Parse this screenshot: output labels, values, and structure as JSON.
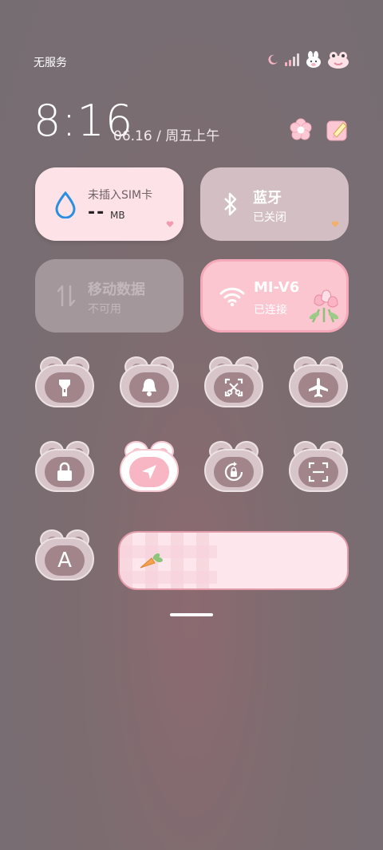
{
  "status": {
    "carrier": "无服务",
    "icons": [
      "moon-icon",
      "signal-icon",
      "bunny-sticker-icon",
      "frog-sticker-icon"
    ]
  },
  "header": {
    "time": "8:16",
    "date": "06.16 / 周五上午",
    "icons": [
      "flower-settings-icon",
      "edit-icon"
    ]
  },
  "tiles": {
    "data": {
      "title": "未插入SIM卡",
      "value": "--",
      "unit": "MB"
    },
    "bluetooth": {
      "title": "蓝牙",
      "sub": "已关闭"
    },
    "mobile": {
      "title": "移动数据",
      "sub": "不可用"
    },
    "wifi": {
      "title": "MI-V6",
      "sub": "已连接"
    }
  },
  "toggles": [
    {
      "icon": "flashlight-icon",
      "active": false
    },
    {
      "icon": "bell-icon",
      "active": false
    },
    {
      "icon": "screenshot-icon",
      "active": false
    },
    {
      "icon": "airplane-icon",
      "active": false
    },
    {
      "icon": "lock-icon",
      "active": false
    },
    {
      "icon": "location-icon",
      "active": true
    },
    {
      "icon": "rotation-lock-icon",
      "active": false
    },
    {
      "icon": "scan-icon",
      "active": false
    },
    {
      "icon": "font-icon",
      "active": false,
      "label": "A"
    }
  ],
  "colors": {
    "tile_pink": "#fde3e8",
    "wifi_pink": "#fbc6d0",
    "accent_blue": "#2a8fe0"
  }
}
